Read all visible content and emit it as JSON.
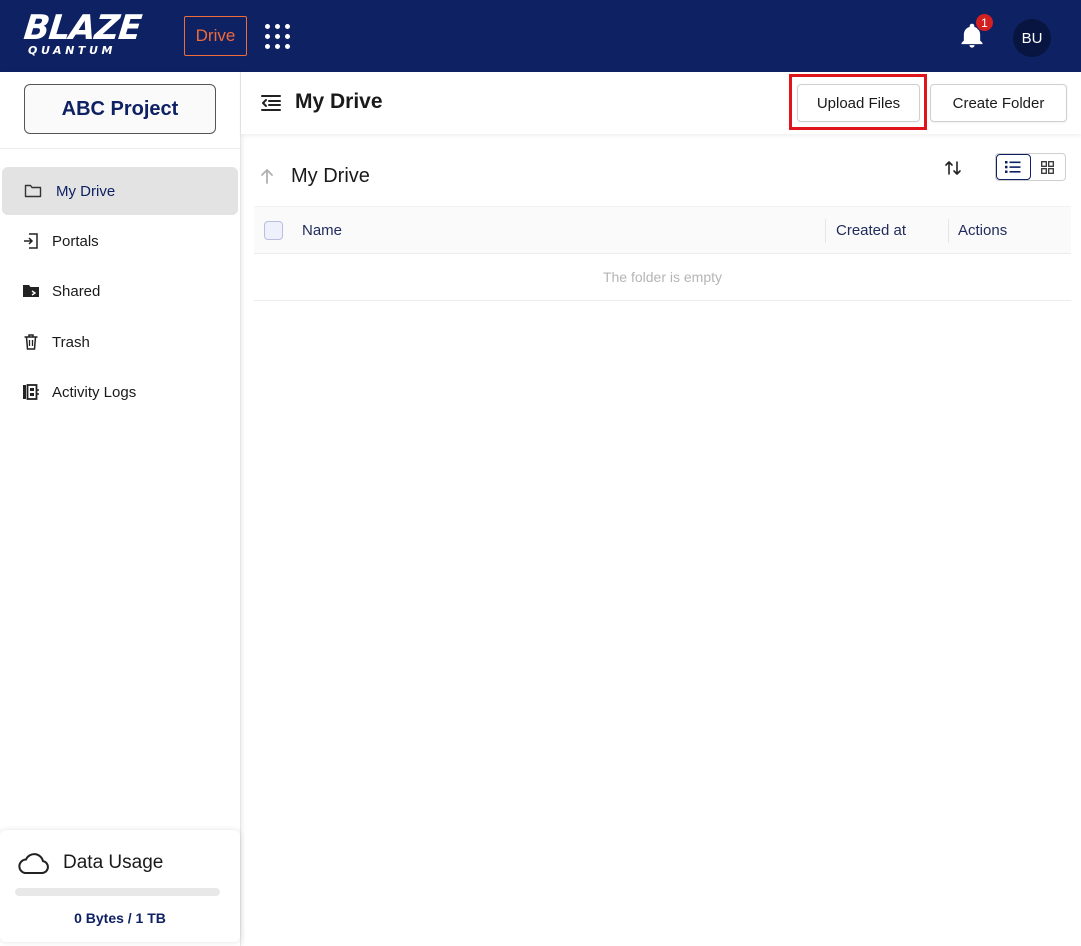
{
  "brand": {
    "logo_main": "BLAZE",
    "logo_sub": "QUANTUM",
    "app_badge": "Drive"
  },
  "topbar": {
    "notification_count": "1",
    "avatar_initials": "BU"
  },
  "sidebar": {
    "project": "ABC Project",
    "items": [
      {
        "label": "My Drive",
        "icon": "folder-icon",
        "active": true
      },
      {
        "label": "Portals",
        "icon": "portal-enter-icon"
      },
      {
        "label": "Shared",
        "icon": "shared-folder-icon"
      },
      {
        "label": "Trash",
        "icon": "trash-icon"
      },
      {
        "label": "Activity Logs",
        "icon": "activity-log-icon"
      }
    ],
    "usage": {
      "title": "Data Usage",
      "text": "0 Bytes / 1 TB",
      "fraction": 0
    }
  },
  "header": {
    "title": "My Drive",
    "upload_label": "Upload Files",
    "create_folder_label": "Create Folder"
  },
  "content": {
    "breadcrumb": "My Drive",
    "columns": {
      "name": "Name",
      "created_at": "Created at",
      "actions": "Actions"
    },
    "empty_message": "The folder is empty"
  },
  "colors": {
    "brand_navy": "#0e2163",
    "accent_orange": "#f06a3a",
    "highlight_red": "#e0151c",
    "badge_red": "#d32020"
  }
}
